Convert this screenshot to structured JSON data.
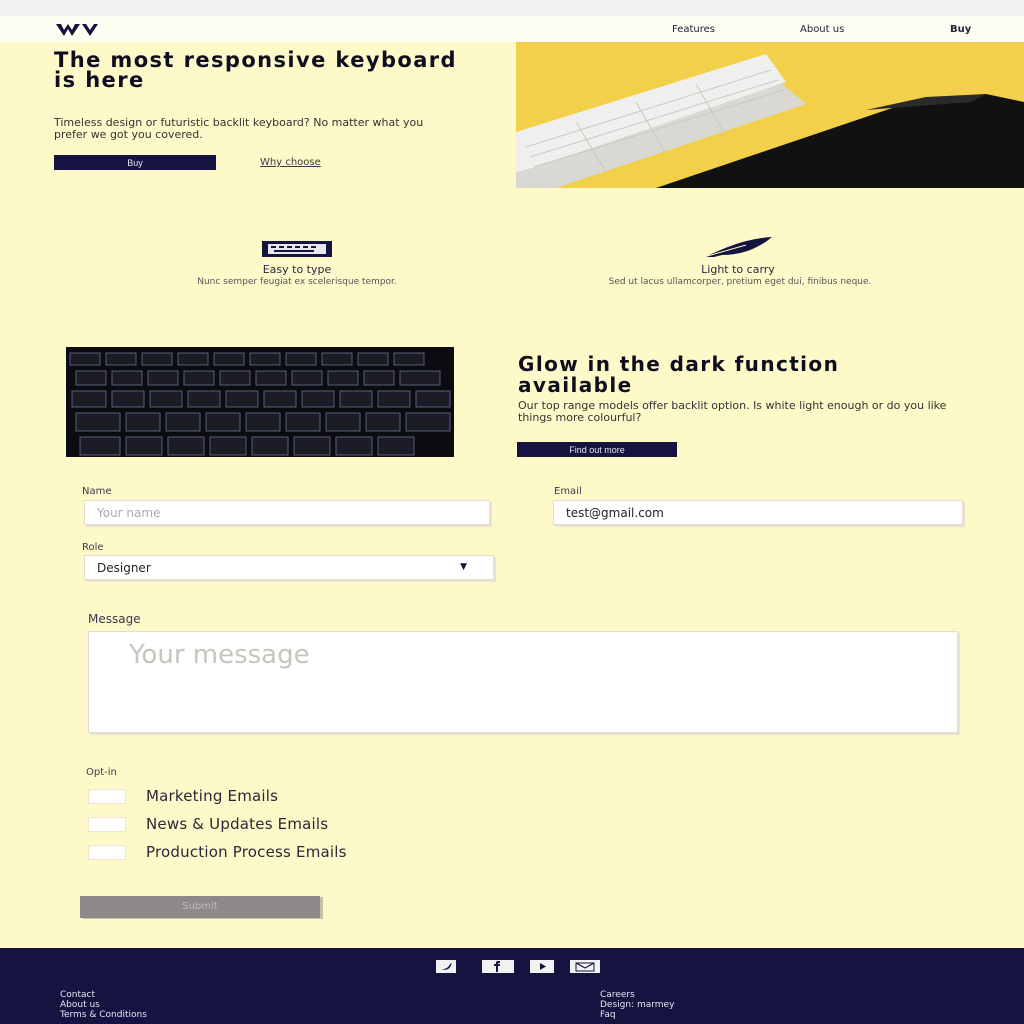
{
  "nav": {
    "links": [
      "Features",
      "About us",
      "Buy"
    ]
  },
  "hero": {
    "title": "The most responsive keyboard is here",
    "description": "Timeless design or futuristic backlit keyboard? No matter what you prefer we got you covered.",
    "cta_label": "Buy",
    "link_label": "Why choose"
  },
  "features": [
    {
      "icon": "keyboard-icon",
      "title": "Easy to type",
      "desc": "Nunc semper feugiat ex scelerisque tempor."
    },
    {
      "icon": "feather-icon",
      "title": "Light to carry",
      "desc": "Sed ut lacus ullamcorper, pretium eget dui, finibus neque."
    }
  ],
  "glow": {
    "title": "Glow in the dark function available",
    "description": "Our top range models offer backlit option. Is white light enough or do you like things more colourful?",
    "button_label": "Find out more"
  },
  "form": {
    "name_label": "Name",
    "name_placeholder": "Your name",
    "email_label": "Email",
    "email_value": "test@gmail.com",
    "role_label": "Role",
    "role_value": "Designer",
    "message_label": "Message",
    "message_placeholder": "Your message",
    "optin_label": "Opt-in",
    "options": [
      "Marketing Emails",
      "News & Updates Emails",
      "Production Process Emails"
    ],
    "submit_label": "Submit"
  },
  "footer": {
    "social_icons": [
      "twitter-icon",
      "facebook-icon",
      "youtube-icon",
      "email-icon"
    ],
    "left_links": [
      "Contact",
      "About us",
      "Terms & Conditions"
    ],
    "right_links": [
      "Careers",
      "Design: marmey",
      "Faq"
    ]
  },
  "colors": {
    "background": "#fef9c9",
    "navy": "#15133f",
    "hero_yellow": "#f3d049"
  }
}
